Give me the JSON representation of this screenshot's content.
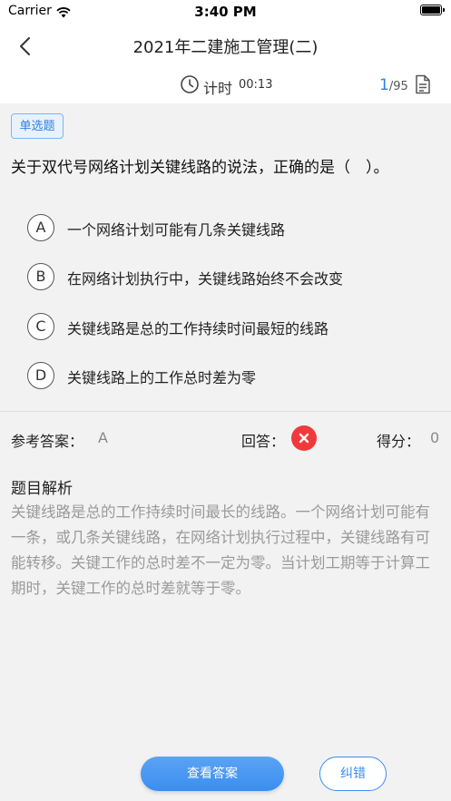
{
  "status_bar": {
    "carrier": "Carrier",
    "time": "3:40 PM"
  },
  "nav": {
    "title": "2021年二建施工管理(二)"
  },
  "timer": {
    "label": "计时",
    "value": "00:13"
  },
  "counter": {
    "current": "1",
    "total": "/95"
  },
  "question": {
    "type": "单选题",
    "text": "关于双代号网络计划关键线路的说法，正确的是（　）。",
    "options": [
      {
        "letter": "A",
        "text": "一个网络计划可能有几条关键线路"
      },
      {
        "letter": "B",
        "text": "在网络计划执行中，关键线路始终不会改变"
      },
      {
        "letter": "C",
        "text": "关键线路是总的工作持续时间最短的线路"
      },
      {
        "letter": "D",
        "text": "关键线路上的工作总时差为零"
      }
    ]
  },
  "result": {
    "reference_label": "参考答案：",
    "reference_value": "A",
    "response_label": "回答：",
    "response_status": "wrong",
    "score_label": "得分：",
    "score_value": "0"
  },
  "analysis": {
    "title": "题目解析",
    "text": "关键线路是总的工作持续时间最长的线路。一个网络计划可能有一条，或几条关键线路，在网络计划执行过程中，关键线路有可能转移。关键工作的总时差不一定为零。当计划工期等于计算工期时，关键工作的总时差就等于零。"
  },
  "buttons": {
    "view_answer": "查看答案",
    "report_error": "纠错"
  },
  "colors": {
    "accent": "#2f7fe4",
    "wrong": "#f0393b",
    "background": "#f2f2f2"
  },
  "icons": {
    "back": "chevron-left-icon",
    "clock": "clock-icon",
    "answer_sheet": "answer-sheet-icon",
    "wrong": "close-icon"
  }
}
